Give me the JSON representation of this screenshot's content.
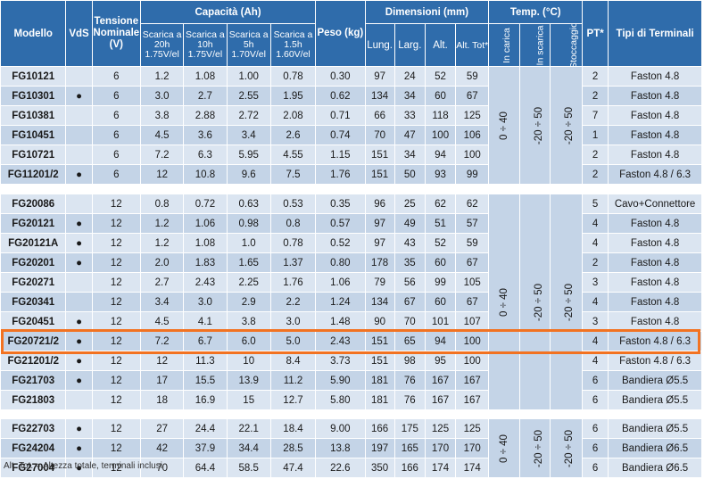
{
  "header": {
    "modello": "Modello",
    "vds": "VdS",
    "tensione": "Tensione Nominale (V)",
    "capacita": "Capacità (Ah)",
    "scariche": [
      "Scarica a 20h 1.75V/el",
      "Scarica a 10h 1.75V/el",
      "Scarica a 5h 1.70V/el",
      "Scarica a 1.5h 1.60V/el"
    ],
    "peso": "Peso (kg)",
    "dimensioni": "Dimensioni (mm)",
    "dim_cols": [
      "Lung.",
      "Larg.",
      "Alt.",
      "Alt. Tot*"
    ],
    "temp": "Temp. (°C)",
    "temp_cols": [
      "In carica",
      "In scarica",
      "Stoccaggio"
    ],
    "pt": "PT*",
    "terminali": "Tipi di Terminali"
  },
  "groups": [
    {
      "temps": [
        "0 ÷ 40",
        "-20 ÷ 50",
        "-20 ÷ 50"
      ],
      "rows": [
        {
          "model": "FG10121",
          "vds": "",
          "v": "6",
          "c20": "1.2",
          "c10": "1.08",
          "c5": "1.00",
          "c15": "0.78",
          "peso": "0.30",
          "lung": "97",
          "larg": "24",
          "alt": "52",
          "tot": "59",
          "pt": "2",
          "term": "Faston 4.8"
        },
        {
          "model": "FG10301",
          "vds": "●",
          "v": "6",
          "c20": "3.0",
          "c10": "2.7",
          "c5": "2.55",
          "c15": "1.95",
          "peso": "0.62",
          "lung": "134",
          "larg": "34",
          "alt": "60",
          "tot": "67",
          "pt": "2",
          "term": "Faston 4.8"
        },
        {
          "model": "FG10381",
          "vds": "",
          "v": "6",
          "c20": "3.8",
          "c10": "2.88",
          "c5": "2.72",
          "c15": "2.08",
          "peso": "0.71",
          "lung": "66",
          "larg": "33",
          "alt": "118",
          "tot": "125",
          "pt": "7",
          "term": "Faston 4.8"
        },
        {
          "model": "FG10451",
          "vds": "",
          "v": "6",
          "c20": "4.5",
          "c10": "3.6",
          "c5": "3.4",
          "c15": "2.6",
          "peso": "0.74",
          "lung": "70",
          "larg": "47",
          "alt": "100",
          "tot": "106",
          "pt": "1",
          "term": "Faston 4.8"
        },
        {
          "model": "FG10721",
          "vds": "",
          "v": "6",
          "c20": "7.2",
          "c10": "6.3",
          "c5": "5.95",
          "c15": "4.55",
          "peso": "1.15",
          "lung": "151",
          "larg": "34",
          "alt": "94",
          "tot": "100",
          "pt": "2",
          "term": "Faston 4.8"
        },
        {
          "model": "FG11201/2",
          "vds": "●",
          "v": "6",
          "c20": "12",
          "c10": "10.8",
          "c5": "9.6",
          "c15": "7.5",
          "peso": "1.76",
          "lung": "151",
          "larg": "50",
          "alt": "93",
          "tot": "99",
          "pt": "2",
          "term": "Faston 4.8 / 6.3"
        }
      ]
    },
    {
      "temps": [
        "0 ÷ 40",
        "-20 ÷ 50",
        "-20 ÷ 50"
      ],
      "rows": [
        {
          "model": "FG20086",
          "vds": "",
          "v": "12",
          "c20": "0.8",
          "c10": "0.72",
          "c5": "0.63",
          "c15": "0.53",
          "peso": "0.35",
          "lung": "96",
          "larg": "25",
          "alt": "62",
          "tot": "62",
          "pt": "5",
          "term": "Cavo+Connettore"
        },
        {
          "model": "FG20121",
          "vds": "●",
          "v": "12",
          "c20": "1.2",
          "c10": "1.06",
          "c5": "0.98",
          "c15": "0.8",
          "peso": "0.57",
          "lung": "97",
          "larg": "49",
          "alt": "51",
          "tot": "57",
          "pt": "4",
          "term": "Faston 4.8"
        },
        {
          "model": "FG20121A",
          "vds": "●",
          "v": "12",
          "c20": "1.2",
          "c10": "1.08",
          "c5": "1.0",
          "c15": "0.78",
          "peso": "0.52",
          "lung": "97",
          "larg": "43",
          "alt": "52",
          "tot": "59",
          "pt": "4",
          "term": "Faston 4.8"
        },
        {
          "model": "FG20201",
          "vds": "●",
          "v": "12",
          "c20": "2.0",
          "c10": "1.83",
          "c5": "1.65",
          "c15": "1.37",
          "peso": "0.80",
          "lung": "178",
          "larg": "35",
          "alt": "60",
          "tot": "67",
          "pt": "2",
          "term": "Faston 4.8"
        },
        {
          "model": "FG20271",
          "vds": "",
          "v": "12",
          "c20": "2.7",
          "c10": "2.43",
          "c5": "2.25",
          "c15": "1.76",
          "peso": "1.06",
          "lung": "79",
          "larg": "56",
          "alt": "99",
          "tot": "105",
          "pt": "3",
          "term": "Faston 4.8"
        },
        {
          "model": "FG20341",
          "vds": "",
          "v": "12",
          "c20": "3.4",
          "c10": "3.0",
          "c5": "2.9",
          "c15": "2.2",
          "peso": "1.24",
          "lung": "134",
          "larg": "67",
          "alt": "60",
          "tot": "67",
          "pt": "4",
          "term": "Faston 4.8"
        },
        {
          "model": "FG20451",
          "vds": "●",
          "v": "12",
          "c20": "4.5",
          "c10": "4.1",
          "c5": "3.8",
          "c15": "3.0",
          "peso": "1.48",
          "lung": "90",
          "larg": "70",
          "alt": "101",
          "tot": "107",
          "pt": "3",
          "term": "Faston 4.8"
        },
        {
          "model": "FG20721/2",
          "vds": "●",
          "v": "12",
          "c20": "7.2",
          "c10": "6.7",
          "c5": "6.0",
          "c15": "5.0",
          "peso": "2.43",
          "lung": "151",
          "larg": "65",
          "alt": "94",
          "tot": "100",
          "pt": "4",
          "term": "Faston 4.8 / 6.3"
        },
        {
          "model": "FG21201/2",
          "vds": "●",
          "v": "12",
          "c20": "12",
          "c10": "11.3",
          "c5": "10",
          "c15": "8.4",
          "peso": "3.73",
          "lung": "151",
          "larg": "98",
          "alt": "95",
          "tot": "100",
          "pt": "4",
          "term": "Faston 4.8 / 6.3"
        },
        {
          "model": "FG21703",
          "vds": "●",
          "v": "12",
          "c20": "17",
          "c10": "15.5",
          "c5": "13.9",
          "c15": "11.2",
          "peso": "5.90",
          "lung": "181",
          "larg": "76",
          "alt": "167",
          "tot": "167",
          "pt": "6",
          "term": "Bandiera Ø5.5"
        },
        {
          "model": "FG21803",
          "vds": "",
          "v": "12",
          "c20": "18",
          "c10": "16.9",
          "c5": "15",
          "c15": "12.7",
          "peso": "5.80",
          "lung": "181",
          "larg": "76",
          "alt": "167",
          "tot": "167",
          "pt": "6",
          "term": "Bandiera Ø5.5"
        }
      ]
    },
    {
      "temps": [
        "0 ÷ 40",
        "-20 ÷ 50",
        "-20 ÷ 50"
      ],
      "rows": [
        {
          "model": "FG22703",
          "vds": "●",
          "v": "12",
          "c20": "27",
          "c10": "24.4",
          "c5": "22.1",
          "c15": "18.4",
          "peso": "9.00",
          "lung": "166",
          "larg": "175",
          "alt": "125",
          "tot": "125",
          "pt": "6",
          "term": "Bandiera Ø5.5"
        },
        {
          "model": "FG24204",
          "vds": "●",
          "v": "12",
          "c20": "42",
          "c10": "37.9",
          "c5": "34.4",
          "c15": "28.5",
          "peso": "13.8",
          "lung": "197",
          "larg": "165",
          "alt": "170",
          "tot": "170",
          "pt": "6",
          "term": "Bandiera Ø6.5"
        },
        {
          "model": "FG27004",
          "vds": "●",
          "v": "12",
          "c20": "70",
          "c10": "64.4",
          "c5": "58.5",
          "c15": "47.4",
          "peso": "22.6",
          "lung": "350",
          "larg": "166",
          "alt": "174",
          "tot": "174",
          "pt": "6",
          "term": "Bandiera Ø6.5"
        }
      ]
    }
  ],
  "highlight_model": "FG20721/2",
  "colors": {
    "header": "#2f6cab",
    "row_light": "#dbe5f1",
    "row_dark": "#c4d4e7",
    "highlight": "#f27221"
  },
  "footnote": "Alt. Tot. = Altezza totale, terminali inclusi"
}
